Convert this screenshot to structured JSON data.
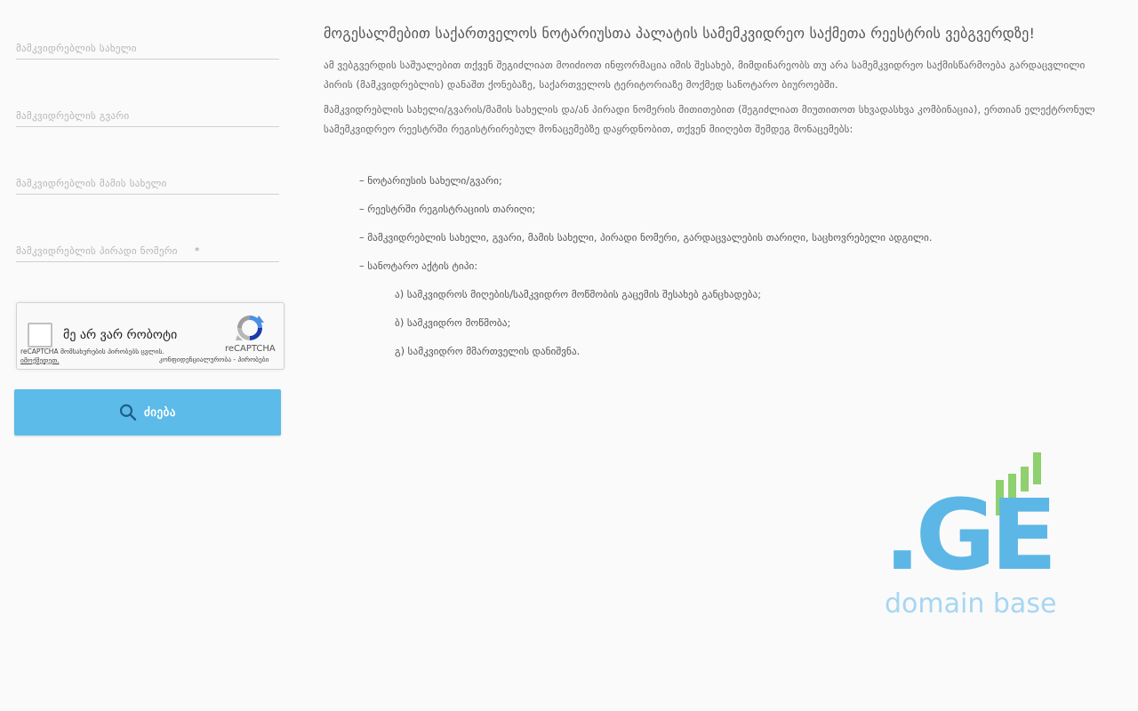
{
  "form": {
    "fields": [
      {
        "placeholder": "მამკვიდრებლის სახელი"
      },
      {
        "placeholder": "მამკვიდრებლის გვარი"
      },
      {
        "placeholder": "მამკვიდრებლის მამის სახელი"
      },
      {
        "placeholder": "მამკვიდრებლის პირადი ნომერი",
        "required_mark": "*"
      }
    ],
    "recaptcha": {
      "label": "მე არ ვარ რობოტი",
      "brand": "reCAPTCHA",
      "footer_text": "reCAPTCHA მომსახურების პირობებს ცვლის.",
      "footer_link": "იმოქმედეთ.",
      "privacy": "კონფიდენციალურობა - პირობები"
    },
    "search_button": {
      "label": "ძიება",
      "icon": "search-icon"
    }
  },
  "content": {
    "title": "მოგესალმებით საქართველოს ნოტარიუსთა პალატის სამემკვიდრეო საქმეთა რეესტრის ვებგვერდზე!",
    "paragraphs": [
      "ამ ვებგვერდის საშუალებით თქვენ შეგიძლიათ მოიძიოთ ინფორმაცია იმის შესახებ, მიმდინარეობს თუ არა სამემკვიდრეო საქმისწარმოება გარდაცვლილი პირის (მამკვიდრებლის) დანაშთ ქონებაზე, საქართველოს ტერიტორიაზე მოქმედ სანოტარო ბიუროებში.",
      "მამკვიდრებლის სახელი/გვარის/მამის სახელის და/ან პირადი ნომერის მითითებით (შეგიძლიათ მიუთითოთ სხვადასხვა კომბინაცია), ერთიან ელექტრონულ სამემკვიდრეო რეესტრში რეგისტრირებულ მონაცემებზე დაყრდნობით, თქვენ მიიღებთ შემდეგ მონაცემებს:"
    ],
    "list": [
      "– ნოტარიუსის სახელი/გვარი;",
      "– რეესტრში რეგისტრაციის თარიღი;",
      "– მამკვიდრებლის სახელი, გვარი, მამის სახელი, პირადი ნომერი, გარდაცვალების თარიღი, საცხოვრებელი ადგილი.",
      "– სანოტარო აქტის ტიპი:"
    ],
    "sublist": [
      "ა) სამკვიდროს მიღების/სამკვიდრო მოწმობის გაცემის შესახებ განცხადება;",
      "ბ) სამკვიდრო მოწმობა;",
      "გ) სამკვიდრო მმართველის დანიშვნა."
    ]
  },
  "logo": {
    "mark": ".GE",
    "tagline": "domain base",
    "colors": {
      "blue": "#5cb6e6",
      "green": "#8fd06f",
      "tagline": "#a6d6f2"
    }
  }
}
